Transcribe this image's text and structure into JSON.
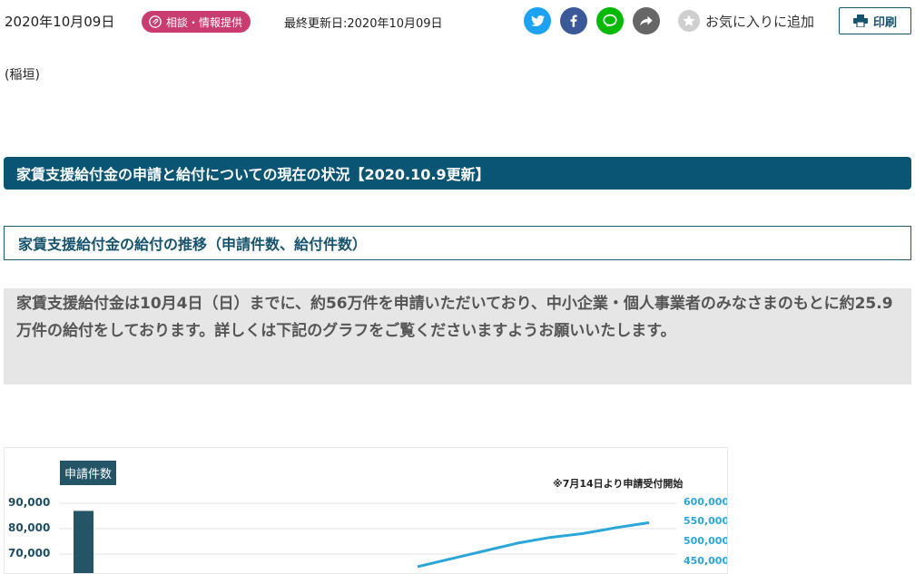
{
  "article": {
    "published": "2020年10月09日",
    "category": "相談・情報提供",
    "updated": "最終更新日:2020年10月09日",
    "author": "(稲垣)"
  },
  "toolbar": {
    "favorite_label": "お気に入りに追加",
    "print_label": "印刷"
  },
  "headings": {
    "h2": "家賃支援給付金の申請と給付についての現在の状況【2020.10.9更新】",
    "h3": "家賃支援給付金の給付の推移（申請件数、給付件数）"
  },
  "notice": "家賃支援給付金は10月4日（日）までに、約56万件を申請いただいており、中小企業・個人事業者のみなさまのもとに約25.9万件の給付をしております。詳しくは下記のグラフをご覧くださいますようお願いいたします。",
  "colors": {
    "category_badge": "#c83c72",
    "heading_bar": "#0b5574",
    "bar": "#235567",
    "line": "#2aa7d8"
  },
  "chart_data": {
    "type": "bar",
    "legend": "申請件数",
    "note": "※7月14日より申請受付開始",
    "y_left": {
      "ticks": [
        "90,000",
        "80,000",
        "70,000"
      ],
      "values": [
        90000,
        80000,
        70000
      ]
    },
    "y_right": {
      "ticks": [
        "600,000",
        "550,000",
        "500,000",
        "450,000"
      ],
      "values": [
        600000,
        550000,
        500000,
        450000
      ]
    },
    "series": [
      {
        "type": "bar",
        "axis": "left",
        "values": [
          87000
        ]
      },
      {
        "type": "line",
        "axis": "right",
        "values": [
          435000,
          455000,
          475000,
          495000,
          510000,
          520000,
          535000,
          548000
        ]
      }
    ]
  }
}
